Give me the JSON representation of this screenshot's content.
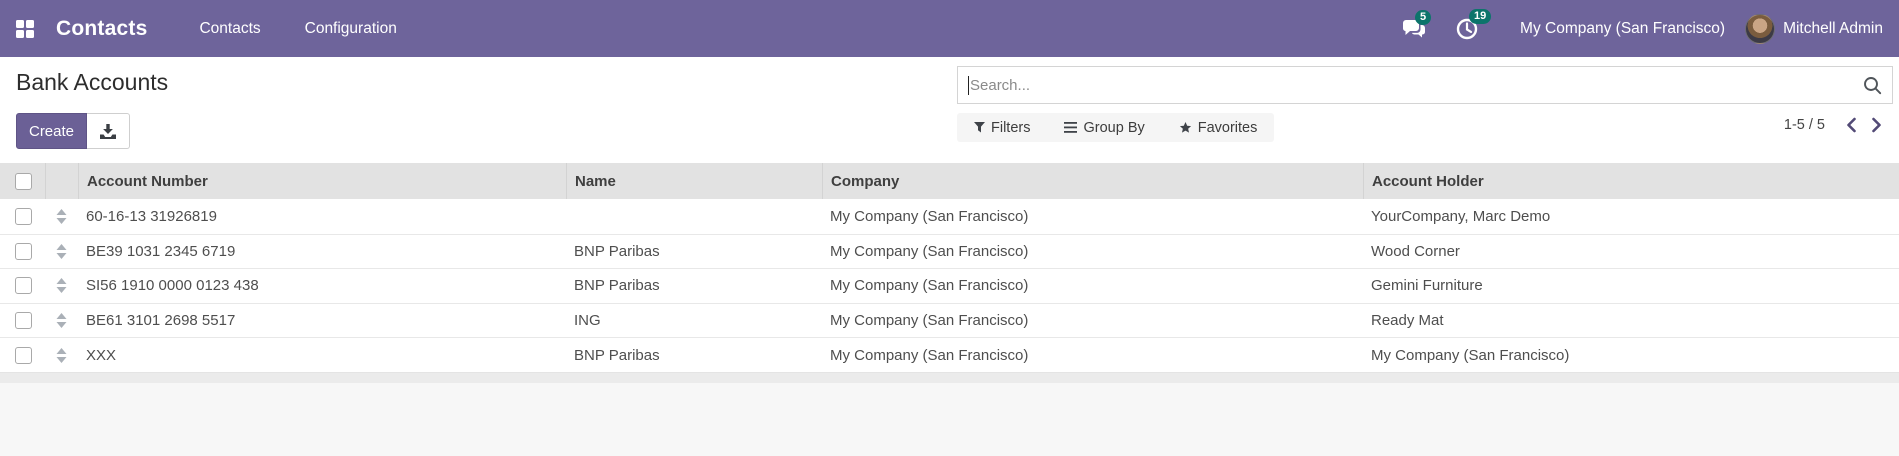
{
  "topbar": {
    "brand": "Contacts",
    "nav_items": [
      {
        "label": "Contacts"
      },
      {
        "label": "Configuration"
      }
    ],
    "messages_count": "5",
    "activities_count": "19",
    "company_switcher": "My Company (San Francisco)",
    "user_name": "Mitchell Admin"
  },
  "control_panel": {
    "title": "Bank Accounts",
    "create_button": "Create",
    "search_placeholder": "Search...",
    "filters_button": "Filters",
    "group_by_button": "Group By",
    "favorites_button": "Favorites",
    "pager_text": "1-5 / 5"
  },
  "table": {
    "columns": [
      "Account Number",
      "Name",
      "Company",
      "Account Holder"
    ],
    "rows": [
      {
        "account_number": "60-16-13 31926819",
        "name": "",
        "company": "My Company (San Francisco)",
        "holder": "YourCompany, Marc Demo"
      },
      {
        "account_number": "BE39 1031 2345 6719",
        "name": "BNP Paribas",
        "company": "My Company (San Francisco)",
        "holder": "Wood Corner"
      },
      {
        "account_number": "SI56 1910 0000 0123 438",
        "name": "BNP Paribas",
        "company": "My Company (San Francisco)",
        "holder": "Gemini Furniture"
      },
      {
        "account_number": "BE61 3101 2698 5517",
        "name": "ING",
        "company": "My Company (San Francisco)",
        "holder": "Ready Mat"
      },
      {
        "account_number": "XXX",
        "name": "BNP Paribas",
        "company": "My Company (San Francisco)",
        "holder": "My Company (San Francisco)"
      }
    ]
  },
  "colors": {
    "topbar_bg": "#6e649b",
    "badge_bg": "#0c746b",
    "create_bg": "#6b6096",
    "header_row_bg": "#e2e2e2",
    "page_bg": "#f7f7f7"
  }
}
